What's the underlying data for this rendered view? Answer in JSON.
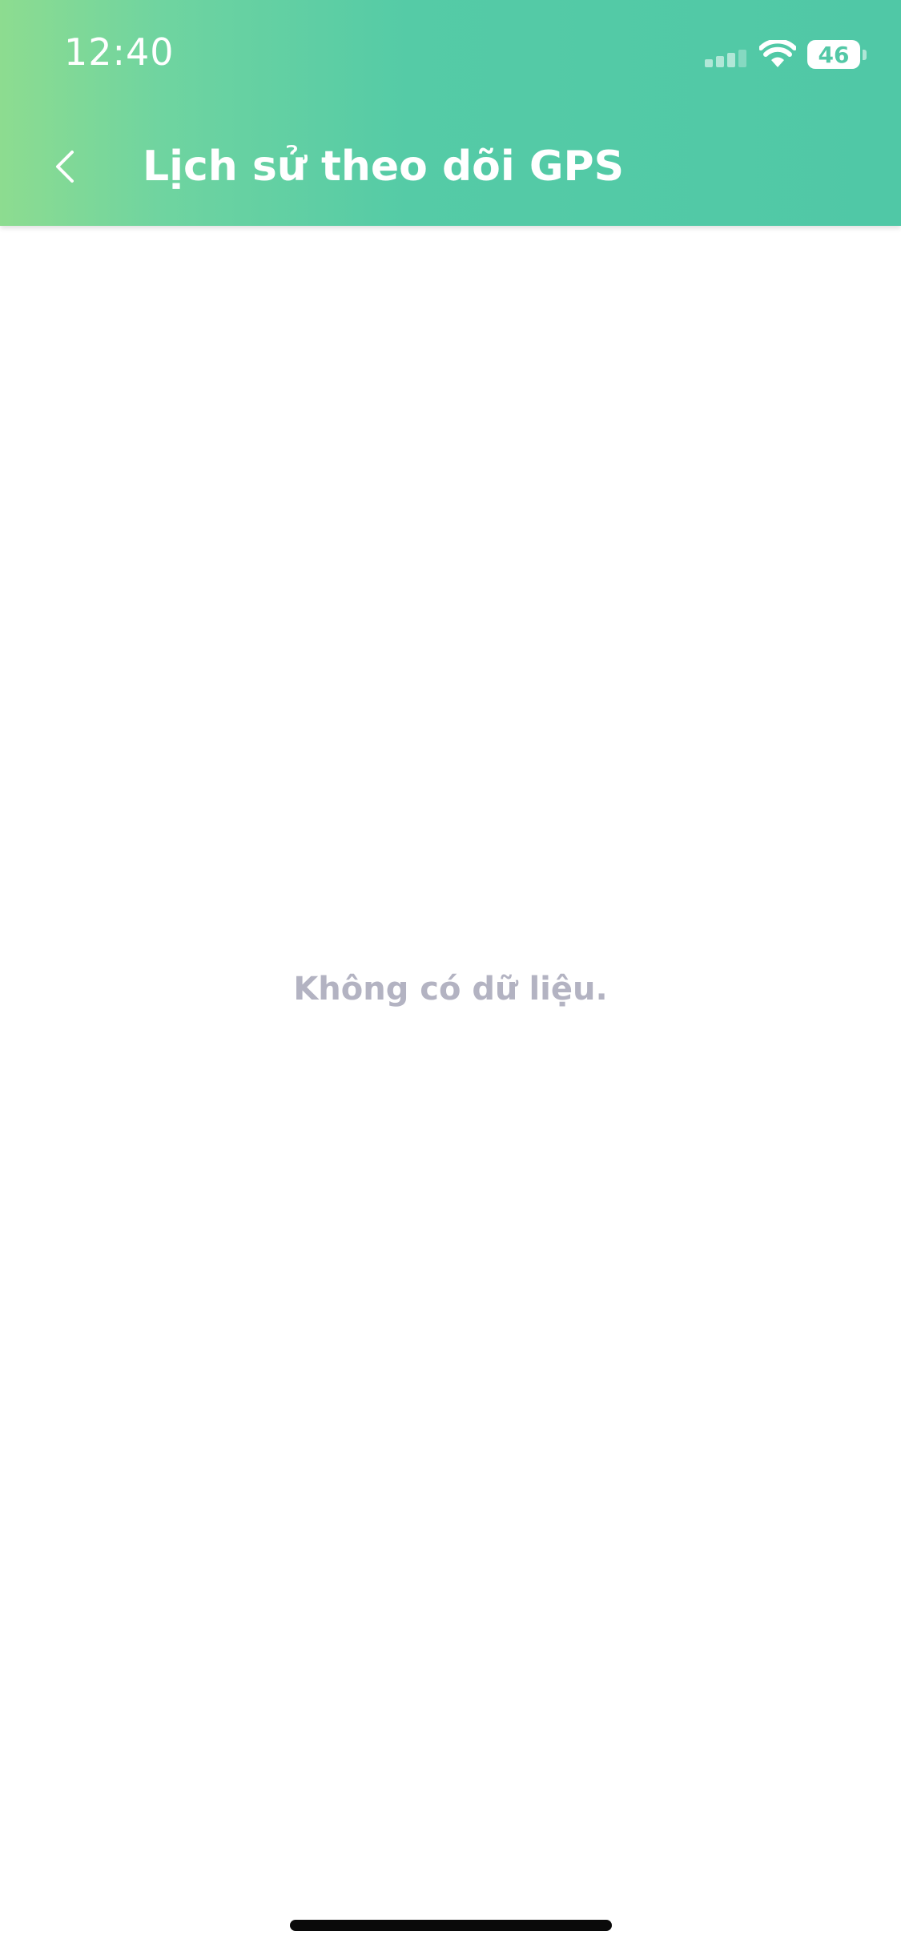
{
  "status_bar": {
    "time": "12:40",
    "battery_level": "46",
    "signal_icon": "cellular-signal-icon",
    "wifi_icon": "wifi-icon"
  },
  "header": {
    "title": "Lịch sử theo dõi GPS",
    "back_icon": "chevron-left-icon",
    "gradient_start": "#8ddc90",
    "gradient_end": "#50c8a6"
  },
  "main": {
    "empty_message": "Không có dữ liệu."
  }
}
